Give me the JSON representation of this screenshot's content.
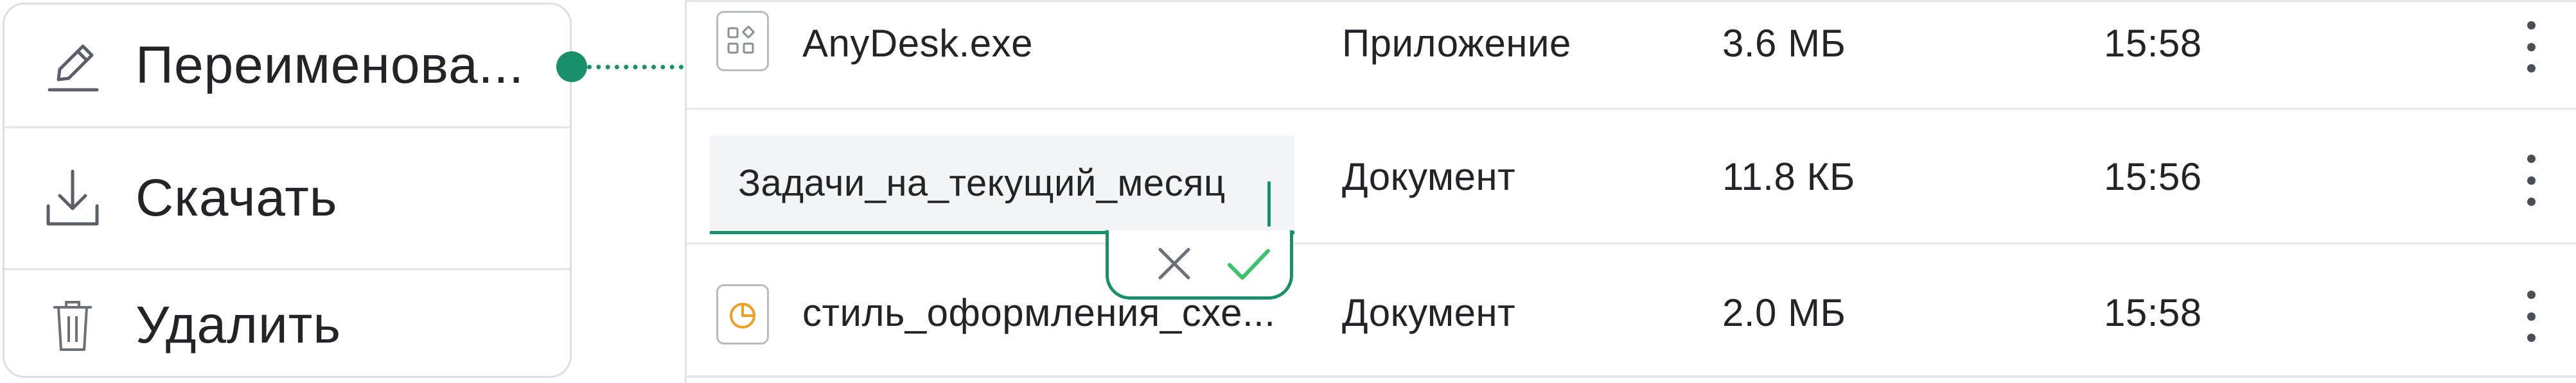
{
  "context_menu": {
    "items": [
      {
        "label": "Переименова...",
        "icon": "pencil-icon"
      },
      {
        "label": "Скачать",
        "icon": "download-icon"
      },
      {
        "label": "Удалить",
        "icon": "trash-icon"
      }
    ]
  },
  "files": [
    {
      "name": "AnyDesk.exe",
      "type": "Приложение",
      "size": "3.6 МБ",
      "time": "15:58",
      "icon": "application-icon"
    },
    {
      "name": "Задачи_на_текущий_месяц",
      "type": "Документ",
      "size": "11.8 КБ",
      "time": "15:56",
      "icon": "document-icon"
    },
    {
      "name": "стиль_оформления_схе...",
      "type": "Документ",
      "size": "2.0 МБ",
      "time": "15:58",
      "icon": "presentation-icon"
    }
  ],
  "rename": {
    "value": "Задачи_на_текущий_месяц",
    "cancel_icon": "close-icon",
    "confirm_icon": "check-icon"
  },
  "colors": {
    "accent": "#1a8f6c",
    "confirm": "#3cc36b",
    "presentation_icon": "#f0a020",
    "border": "#dcdfe3"
  }
}
